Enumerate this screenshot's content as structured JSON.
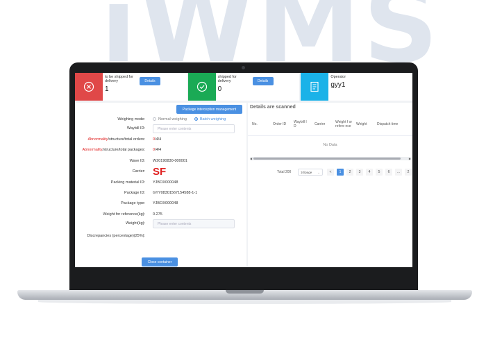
{
  "brand": "iWMS",
  "cards": [
    {
      "label": "to be shipped for delivery",
      "value": "1",
      "details": "Details",
      "color": "#e04848"
    },
    {
      "label": "shipped for delivery",
      "value": "0",
      "details": "Details",
      "color": "#1aaa55"
    },
    {
      "label": "Operator",
      "value": "gyy1",
      "color": "#1ab2e8"
    }
  ],
  "form": {
    "interception_button": "Package interception management",
    "weighing_mode_label": "Weighing mode:",
    "weighing_options": [
      "Normal weighing",
      "Batch weighing"
    ],
    "selected_weighing": "Batch weighing",
    "waybill_label": "Waybill ID:",
    "waybill_placeholder": "Please enter contents",
    "orders_label_red": "Abnormality",
    "orders_label_rest": "/structure/total orders:",
    "orders_value_red": "0",
    "orders_value_rest": "/4/4",
    "packages_label_red": "Abnormality",
    "packages_label_rest": "/structure/total packages:",
    "packages_value_red": "0",
    "packages_value_rest": "/4/4",
    "wave_label": "Wave ID:",
    "wave_value": "W20190830-000001",
    "carrier_label": "Carrier:",
    "carrier_value": "SF",
    "packing_label": "Packing material ID:",
    "packing_value": "YJBOX000048",
    "package_id_label": "Package ID:",
    "package_id_value": "GYY08301567154588-1-1",
    "package_type_label": "Package type:",
    "package_type_value": "YJBOX000048",
    "ref_weight_label": "Weight for reference(kg):",
    "ref_weight_value": "0.275",
    "weight_label": "Weight(kg):",
    "weight_placeholder": "Please enter contents",
    "discrepancy_label": "Discrepancies (percentage)(25%):",
    "close_button": "Close container"
  },
  "scanned": {
    "title": "Details are scanned",
    "columns": [
      "No.",
      "Order ID",
      "Waybill I D",
      "Carrier",
      "Weight f or refere nce",
      "Weight",
      "Dispatch time"
    ],
    "empty_text": "No Data",
    "total_text": "Total 200",
    "page_size": "10/page",
    "pages": [
      "1",
      "2",
      "3",
      "4",
      "5",
      "6",
      "...",
      "2"
    ],
    "current_page": "1",
    "prev": "<"
  }
}
